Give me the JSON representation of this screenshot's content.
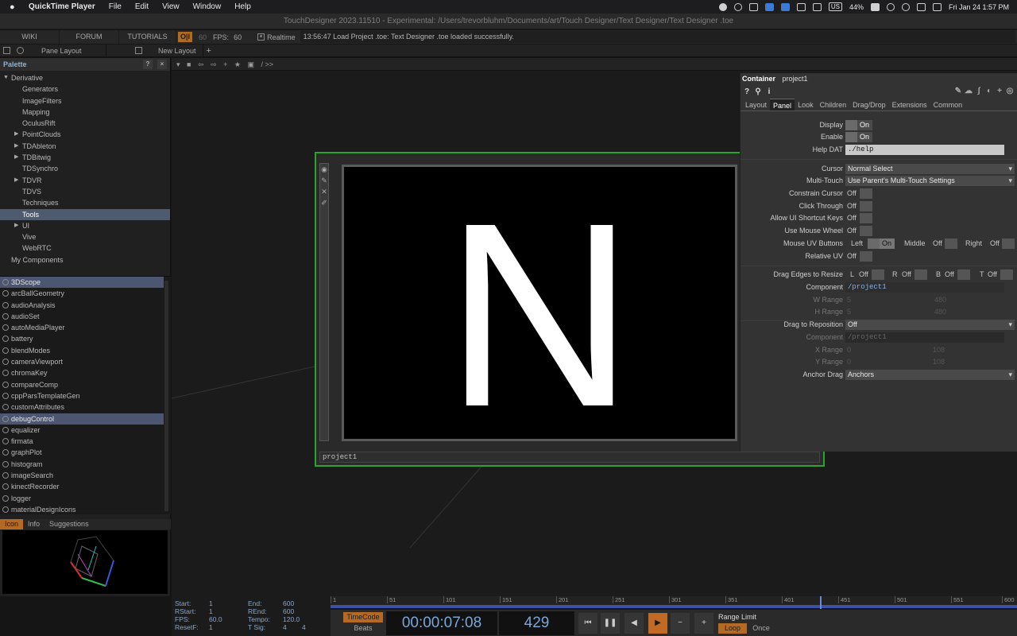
{
  "menubar": {
    "app": "QuickTime Player",
    "items": [
      "File",
      "Edit",
      "View",
      "Window",
      "Help"
    ],
    "keyboard": "US",
    "battery": "44%",
    "datetime": "Fri Jan 24  1:57 PM"
  },
  "window": {
    "title": "TouchDesigner 2023.11510 - Experimental: /Users/trevorbluhm/Documents/art/Touch Designer/Text Designer/Text Designer .toe"
  },
  "topbar": {
    "wiki": "WIKI",
    "forum": "FORUM",
    "tutorials": "TUTORIALS",
    "oi": "O|I",
    "oi_num": "60",
    "fps_label": "FPS:",
    "fps_value": "60",
    "realtime": "Realtime",
    "log": "13:56:47 Load Project .toe: Text Designer .toe loaded successfully."
  },
  "panebar": {
    "pane_layout": "Pane Layout",
    "new_layout": "New Layout"
  },
  "palette": {
    "title": "Palette",
    "help": "?",
    "close": "×",
    "tree": [
      {
        "label": "Derivative",
        "indent": 0,
        "arrow": "down"
      },
      {
        "label": "Generators",
        "indent": 2,
        "arrow": ""
      },
      {
        "label": "ImageFilters",
        "indent": 2,
        "arrow": ""
      },
      {
        "label": "Mapping",
        "indent": 2,
        "arrow": ""
      },
      {
        "label": "OculusRift",
        "indent": 2,
        "arrow": ""
      },
      {
        "label": "PointClouds",
        "indent": 2,
        "arrow": "right"
      },
      {
        "label": "TDAbleton",
        "indent": 2,
        "arrow": "right"
      },
      {
        "label": "TDBitwig",
        "indent": 2,
        "arrow": "right"
      },
      {
        "label": "TDSynchro",
        "indent": 2,
        "arrow": ""
      },
      {
        "label": "TDVR",
        "indent": 2,
        "arrow": "right"
      },
      {
        "label": "TDVS",
        "indent": 2,
        "arrow": ""
      },
      {
        "label": "Techniques",
        "indent": 2,
        "arrow": ""
      },
      {
        "label": "Tools",
        "indent": 2,
        "arrow": "",
        "selected": true
      },
      {
        "label": "UI",
        "indent": 2,
        "arrow": "right"
      },
      {
        "label": "Vive",
        "indent": 2,
        "arrow": ""
      },
      {
        "label": "WebRTC",
        "indent": 2,
        "arrow": ""
      },
      {
        "label": "My Components",
        "indent": 1,
        "arrow": ""
      }
    ],
    "components": [
      {
        "label": "3DScope",
        "selected": true
      },
      {
        "label": "arcBallGeometry"
      },
      {
        "label": "audioAnalysis"
      },
      {
        "label": "audioSet"
      },
      {
        "label": "autoMediaPlayer"
      },
      {
        "label": "battery"
      },
      {
        "label": "blendModes"
      },
      {
        "label": "cameraViewport"
      },
      {
        "label": "chromaKey"
      },
      {
        "label": "compareComp"
      },
      {
        "label": "cppParsTemplateGen"
      },
      {
        "label": "customAttributes"
      },
      {
        "label": "debugControl",
        "selected": true
      },
      {
        "label": "equalizer"
      },
      {
        "label": "firmata"
      },
      {
        "label": "graphPlot"
      },
      {
        "label": "histogram"
      },
      {
        "label": "imageSearch"
      },
      {
        "label": "kinectRecorder"
      },
      {
        "label": "logger"
      },
      {
        "label": "materialDesignIcons"
      }
    ],
    "info_tabs": [
      "Icon",
      "Info",
      "Suggestions"
    ]
  },
  "network": {
    "path": "/ >>"
  },
  "node": {
    "name": "project1",
    "letter": "N"
  },
  "params": {
    "op_type": "Container",
    "op_name": "project1",
    "tabs": [
      "Layout",
      "Panel",
      "Look",
      "Children",
      "Drag/Drop",
      "Extensions",
      "Common"
    ],
    "active_tab": "Panel",
    "display_label": "Display",
    "display_val": "On",
    "enable_label": "Enable",
    "enable_val": "On",
    "helpdat_label": "Help DAT",
    "helpdat_val": "./help",
    "cursor_label": "Cursor",
    "cursor_val": "Normal Select",
    "multitouch_label": "Multi-Touch",
    "multitouch_val": "Use Parent's Multi-Touch Settings",
    "constrain_label": "Constrain Cursor",
    "constrain_val": "Off",
    "clickthrough_label": "Click Through",
    "clickthrough_val": "Off",
    "shortcut_label": "Allow UI Shortcut Keys",
    "shortcut_val": "Off",
    "wheel_label": "Use Mouse Wheel",
    "wheel_val": "Off",
    "uvbtn_label": "Mouse UV Buttons",
    "uv_left": "Left",
    "uv_left_val": "On",
    "uv_middle": "Middle",
    "uv_middle_val": "Off",
    "uv_right": "Right",
    "uv_right_val": "Off",
    "reluv_label": "Relative UV",
    "reluv_val": "Off",
    "dragedges_label": "Drag Edges to Resize",
    "de_l": "L",
    "de_r": "R",
    "de_b": "B",
    "de_t": "T",
    "de_val": "Off",
    "component_label": "Component",
    "component_val": "/project1",
    "wrange_label": "W Range",
    "wrange_a": "5",
    "wrange_b": "480",
    "hrange_label": "H Range",
    "hrange_a": "5",
    "hrange_b": "480",
    "dragrepos_label": "Drag to Reposition",
    "dragrepos_val": "Off",
    "component2_label": "Component",
    "component2_val": "/project1",
    "xrange_label": "X Range",
    "xrange_a": "0",
    "xrange_b": "108",
    "yrange_label": "Y Range",
    "yrange_a": "0",
    "yrange_b": "108",
    "anchor_label": "Anchor Drag",
    "anchor_val": "Anchors"
  },
  "timeline": {
    "start_l": "Start:",
    "start_v": "1",
    "rstart_l": "RStart:",
    "rstart_v": "1",
    "fps_l": "FPS:",
    "fps_v": "60.0",
    "resetf_l": "ResetF:",
    "resetf_v": "1",
    "end_l": "End:",
    "end_v": "600",
    "rend_l": "REnd:",
    "rend_v": "600",
    "tempo_l": "Tempo:",
    "tempo_v": "120.0",
    "tsig_l": "T Sig:",
    "tsig_a": "4",
    "tsig_b": "4",
    "ticks": [
      "1",
      "51",
      "101",
      "151",
      "201",
      "251",
      "301",
      "351",
      "401",
      "451",
      "501",
      "551",
      "600"
    ],
    "timecode_label": "TimeCode",
    "beats_label": "Beats",
    "timecode": "00:00:07:08",
    "frame": "429",
    "range_limit": "Range Limit",
    "loop": "Loop",
    "once": "Once"
  }
}
